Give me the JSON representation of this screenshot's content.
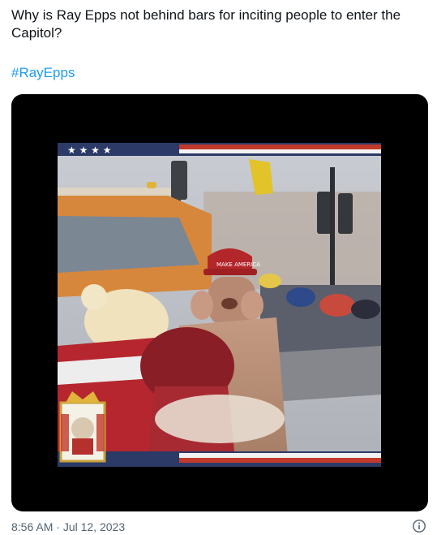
{
  "tweet": {
    "text": "Why is Ray Epps not behind bars for inciting people to enter the Capitol?",
    "hashtag": "#RayEpps",
    "timestamp": "8:56 AM",
    "separator": "·",
    "date": "Jul 12, 2023"
  },
  "media": {
    "type": "video",
    "hat_text": "MAKE AMERICA"
  },
  "icons": {
    "info": "info-circle-icon"
  },
  "colors": {
    "link": "#1d9bf0",
    "text": "#0f1419",
    "secondary": "#536471",
    "media_bg": "#000000"
  }
}
